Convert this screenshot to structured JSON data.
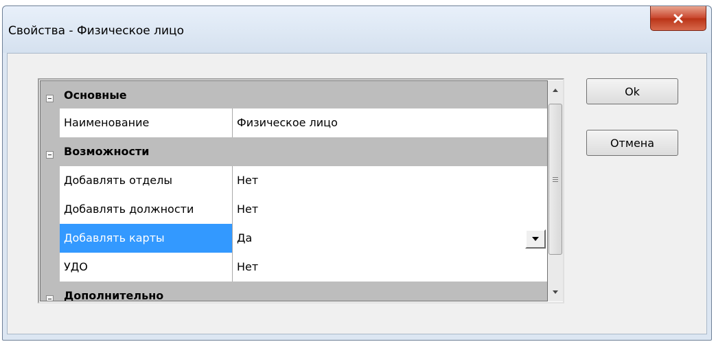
{
  "window": {
    "title": "Свойства - Физическое лицо",
    "close_label": "x"
  },
  "grid": {
    "rows": [
      {
        "type": "category",
        "label": "Основные"
      },
      {
        "type": "property",
        "name": "Наименование",
        "value": "Физическое лицо"
      },
      {
        "type": "category",
        "label": "Возможности"
      },
      {
        "type": "property",
        "name": "Добавлять отделы",
        "value": "Нет"
      },
      {
        "type": "property",
        "name": "Добавлять должности",
        "value": "Нет"
      },
      {
        "type": "property",
        "name": "Добавлять карты",
        "value": "Да",
        "selected": true,
        "has_dropdown": true
      },
      {
        "type": "property",
        "name": "УДО",
        "value": "Нет"
      },
      {
        "type": "category",
        "label": "Дополнительно"
      }
    ]
  },
  "buttons": {
    "ok_label": "Ok",
    "cancel_label": "Отмена"
  },
  "colors": {
    "selection": "#3399ff",
    "category_bg": "#bdbdbd",
    "close_button": "#c8452c"
  },
  "icons": {
    "expander": "collapse-minus-icon",
    "dropdown": "chevron-down-icon",
    "scroll_up": "arrow-up-icon",
    "scroll_down": "arrow-down-icon",
    "close": "close-icon"
  }
}
